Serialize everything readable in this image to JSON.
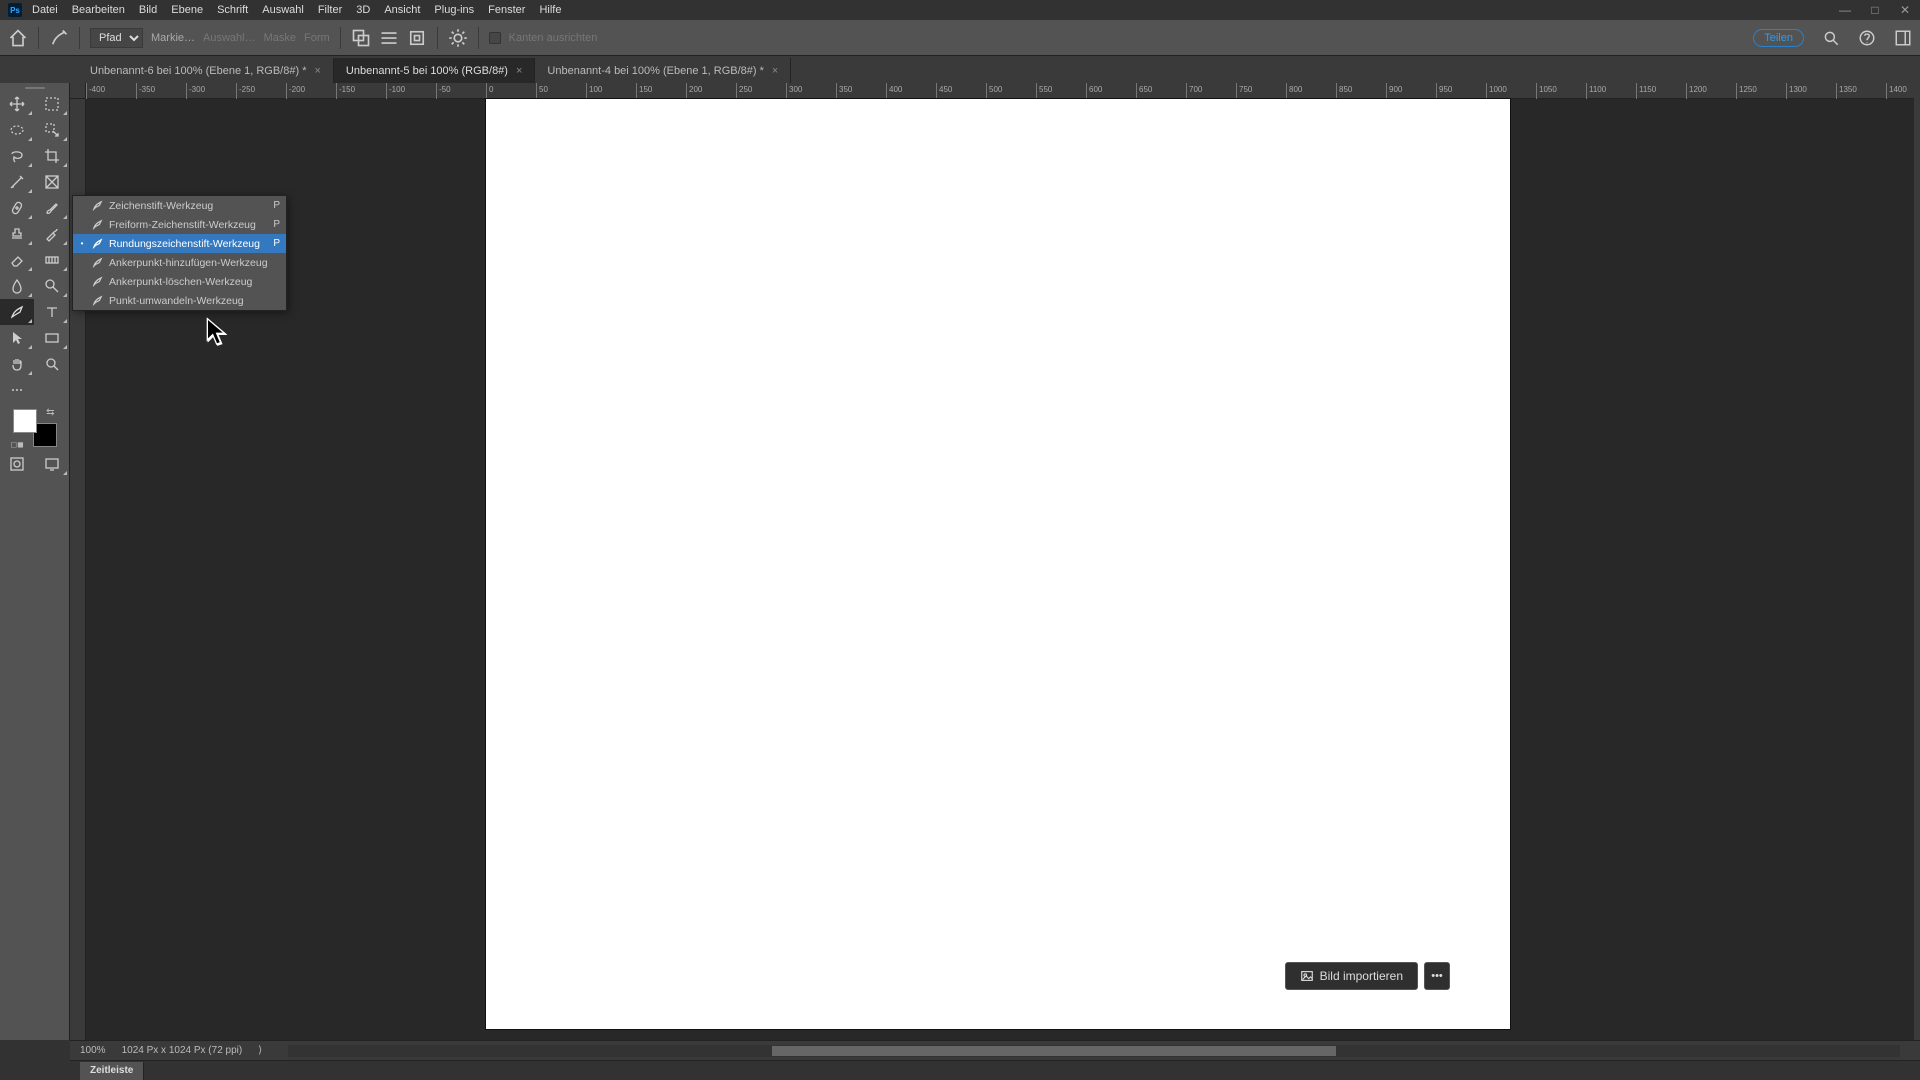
{
  "menu": {
    "items": [
      "Datei",
      "Bearbeiten",
      "Bild",
      "Ebene",
      "Schrift",
      "Auswahl",
      "Filter",
      "3D",
      "Ansicht",
      "Plug-ins",
      "Fenster",
      "Hilfe"
    ]
  },
  "windowControls": {
    "min": "—",
    "max": "□",
    "close": "✕"
  },
  "optionbar": {
    "mode_label": "Pfad",
    "markie": "Markie…",
    "auswahl": "Auswahl…",
    "maske": "Maske",
    "form": "Form",
    "kanten": "Kanten ausrichten",
    "share": "Teilen"
  },
  "tabs": [
    {
      "label": "Unbenannt-6 bei 100% (Ebene 1, RGB/8#) *",
      "active": false
    },
    {
      "label": "Unbenannt-5 bei 100% (RGB/8#)",
      "active": true
    },
    {
      "label": "Unbenannt-4 bei 100% (Ebene 1, RGB/8#) *",
      "active": false
    }
  ],
  "ruler": {
    "start": -400,
    "end": 1450,
    "step": 50,
    "majorEvery": 1
  },
  "flyout": {
    "items": [
      {
        "label": "Zeichenstift-Werkzeug",
        "shortcut": "P",
        "active": false
      },
      {
        "label": "Freiform-Zeichenstift-Werkzeug",
        "shortcut": "P",
        "active": false
      },
      {
        "label": "Rundungszeichenstift-Werkzeug",
        "shortcut": "P",
        "active": true
      },
      {
        "label": "Ankerpunkt-hinzufügen-Werkzeug",
        "shortcut": "",
        "active": false
      },
      {
        "label": "Ankerpunkt-löschen-Werkzeug",
        "shortcut": "",
        "active": false
      },
      {
        "label": "Punkt-umwandeln-Werkzeug",
        "shortcut": "",
        "active": false
      }
    ]
  },
  "import": {
    "label": "Bild importieren",
    "more": "•••"
  },
  "status": {
    "zoom": "100%",
    "dims": "1024 Px x 1024 Px (72 ppi)",
    "arrow": "⟩"
  },
  "timeline": {
    "label": "Zeitleiste"
  }
}
